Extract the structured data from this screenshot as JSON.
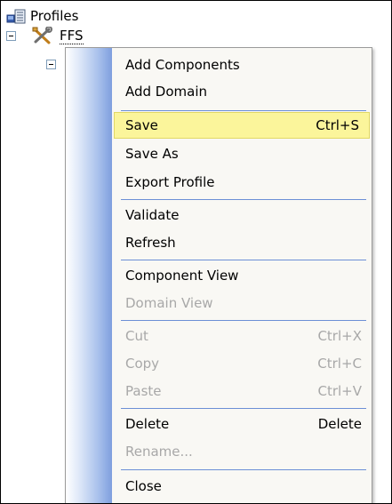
{
  "tree": {
    "root_label": "Profiles",
    "child_label": "FFS"
  },
  "icons": {
    "root": "profiles-icon",
    "child": "tools-icon"
  },
  "menu": {
    "items": [
      {
        "label": "Add Components",
        "shortcut": "",
        "enabled": true
      },
      {
        "label": "Add Domain",
        "shortcut": "",
        "enabled": true
      },
      {
        "label": "Save",
        "shortcut": "Ctrl+S",
        "enabled": true,
        "highlighted": true
      },
      {
        "label": "Save As",
        "shortcut": "",
        "enabled": true
      },
      {
        "label": "Export Profile",
        "shortcut": "",
        "enabled": true
      },
      {
        "label": "Validate",
        "shortcut": "",
        "enabled": true
      },
      {
        "label": "Refresh",
        "shortcut": "",
        "enabled": true
      },
      {
        "label": "Component View",
        "shortcut": "",
        "enabled": true
      },
      {
        "label": "Domain View",
        "shortcut": "",
        "enabled": false
      },
      {
        "label": "Cut",
        "shortcut": "Ctrl+X",
        "enabled": false
      },
      {
        "label": "Copy",
        "shortcut": "Ctrl+C",
        "enabled": false
      },
      {
        "label": "Paste",
        "shortcut": "Ctrl+V",
        "enabled": false
      },
      {
        "label": "Delete",
        "shortcut": "Delete",
        "enabled": true
      },
      {
        "label": "Rename...",
        "shortcut": "",
        "enabled": false
      },
      {
        "label": "Close",
        "shortcut": "",
        "enabled": true
      }
    ]
  },
  "colors": {
    "highlight": "#fbf59b",
    "separator": "#6c8fd6",
    "disabled_text": "#a8a8a8"
  }
}
